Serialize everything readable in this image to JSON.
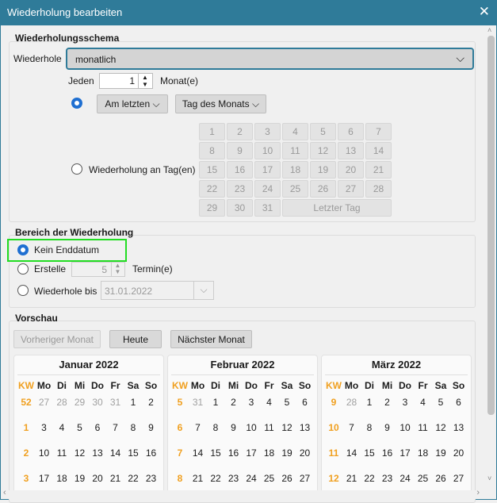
{
  "window": {
    "title": "Wiederholung bearbeiten",
    "close": "✕"
  },
  "schema": {
    "title": "Wiederholungsschema",
    "repeat_label": "Wiederhole",
    "repeat_value": "monatlich",
    "every_label": "Jeden",
    "every_value": "1",
    "every_unit": "Monat(e)",
    "option1_selected": true,
    "position_value": "Am letzten",
    "type_value": "Tag des Monats",
    "option2_label": "Wiederholung an Tag(en)",
    "days": [
      "1",
      "2",
      "3",
      "4",
      "5",
      "6",
      "7",
      "8",
      "9",
      "10",
      "11",
      "12",
      "13",
      "14",
      "15",
      "16",
      "17",
      "18",
      "19",
      "20",
      "21",
      "22",
      "23",
      "24",
      "25",
      "26",
      "27",
      "28",
      "29",
      "30",
      "31"
    ],
    "last_day": "Letzter Tag"
  },
  "range": {
    "title": "Bereich der Wiederholung",
    "no_end": "Kein Enddatum",
    "create": "Erstelle",
    "create_value": "5",
    "create_unit": "Termin(e)",
    "until": "Wiederhole bis",
    "until_value": "31.01.2022",
    "selected": "no_end",
    "highlight_color": "#22dd22"
  },
  "preview": {
    "title": "Vorschau",
    "prev": "Vorheriger Monat",
    "today": "Heute",
    "next": "Nächster Monat",
    "weekday_headers": [
      "KW",
      "Mo",
      "Di",
      "Mi",
      "Do",
      "Fr",
      "Sa",
      "So"
    ],
    "months": [
      {
        "title": "Januar 2022",
        "weeks": [
          {
            "kw": "52",
            "days": [
              "27",
              "28",
              "29",
              "30",
              "31",
              "1",
              "2"
            ],
            "other": 5
          },
          {
            "kw": "1",
            "days": [
              "3",
              "4",
              "5",
              "6",
              "7",
              "8",
              "9"
            ],
            "other": 0
          },
          {
            "kw": "2",
            "days": [
              "10",
              "11",
              "12",
              "13",
              "14",
              "15",
              "16"
            ],
            "other": 0
          },
          {
            "kw": "3",
            "days": [
              "17",
              "18",
              "19",
              "20",
              "21",
              "22",
              "23"
            ],
            "other": 0
          }
        ]
      },
      {
        "title": "Februar 2022",
        "weeks": [
          {
            "kw": "5",
            "days": [
              "31",
              "1",
              "2",
              "3",
              "4",
              "5",
              "6"
            ],
            "other": 1
          },
          {
            "kw": "6",
            "days": [
              "7",
              "8",
              "9",
              "10",
              "11",
              "12",
              "13"
            ],
            "other": 0
          },
          {
            "kw": "7",
            "days": [
              "14",
              "15",
              "16",
              "17",
              "18",
              "19",
              "20"
            ],
            "other": 0
          },
          {
            "kw": "8",
            "days": [
              "21",
              "22",
              "23",
              "24",
              "25",
              "26",
              "27"
            ],
            "other": 0
          }
        ]
      },
      {
        "title": "März 2022",
        "weeks": [
          {
            "kw": "9",
            "days": [
              "28",
              "1",
              "2",
              "3",
              "4",
              "5",
              "6"
            ],
            "other": 1
          },
          {
            "kw": "10",
            "days": [
              "7",
              "8",
              "9",
              "10",
              "11",
              "12",
              "13"
            ],
            "other": 0
          },
          {
            "kw": "11",
            "days": [
              "14",
              "15",
              "16",
              "17",
              "18",
              "19",
              "20"
            ],
            "other": 0
          },
          {
            "kw": "12",
            "days": [
              "21",
              "22",
              "23",
              "24",
              "25",
              "26",
              "27"
            ],
            "other": 0
          }
        ]
      }
    ]
  }
}
